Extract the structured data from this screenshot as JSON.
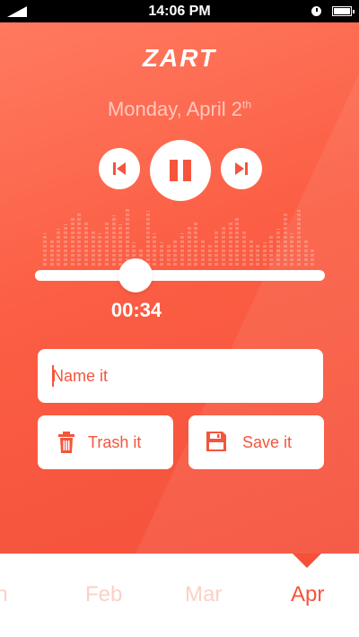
{
  "status_bar": {
    "time": "14:06 PM",
    "icons": [
      "signal-icon",
      "alarm-icon",
      "battery-icon"
    ]
  },
  "app": {
    "logo": "ZART",
    "date_text": "Monday, April 2",
    "date_suffix": "th"
  },
  "player": {
    "controls": [
      "skip-previous-icon",
      "pause-icon",
      "skip-next-icon"
    ],
    "elapsed": "00:34",
    "progress_fraction": 0.35,
    "visualizer_levels": [
      0.55,
      0.45,
      0.62,
      0.7,
      0.8,
      0.9,
      0.75,
      0.6,
      0.55,
      0.75,
      0.85,
      0.7,
      0.95,
      0.4,
      0.3,
      0.92,
      0.55,
      0.4,
      0.35,
      0.45,
      0.55,
      0.65,
      0.72,
      0.45,
      0.38,
      0.6,
      0.68,
      0.75,
      0.8,
      0.58,
      0.45,
      0.35,
      0.4,
      0.5,
      0.62,
      0.88,
      0.55,
      0.94,
      0.42,
      0.3
    ]
  },
  "form": {
    "name_placeholder": "Name it",
    "trash_label": "Trash it",
    "save_label": "Save it"
  },
  "months": {
    "items": [
      "Jan",
      "Feb",
      "Mar",
      "Apr"
    ],
    "visible_first": "an",
    "selected": "Apr"
  },
  "colors": {
    "accent": "#f4553c",
    "background": "#fb5e44",
    "inactive_month": "#fbd0c6"
  }
}
